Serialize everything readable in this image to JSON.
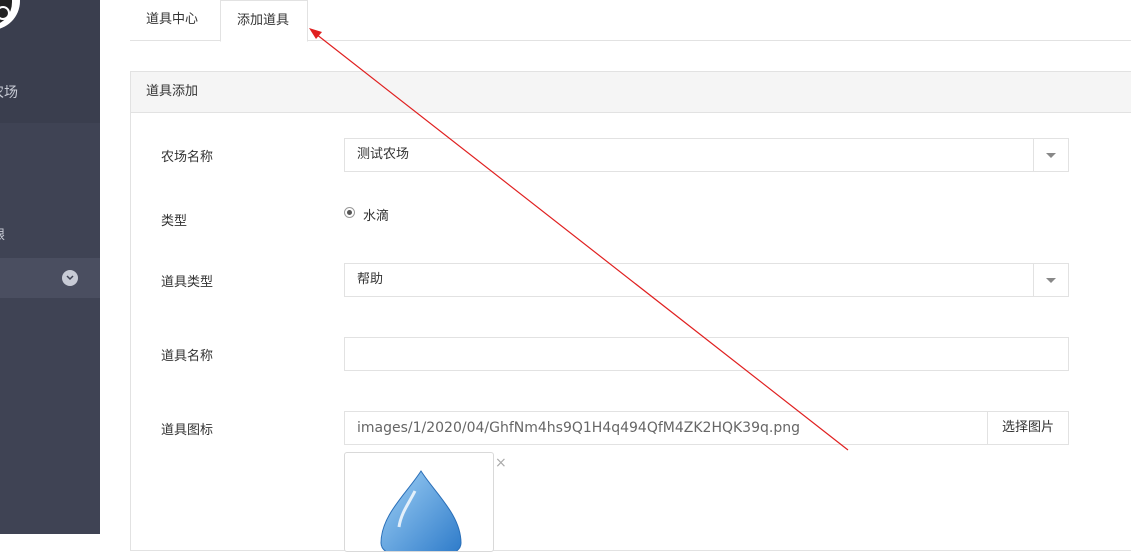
{
  "sidebar": {
    "brand_label": "农场",
    "menu_item_label": "限"
  },
  "tabs": [
    {
      "label": "道具中心"
    },
    {
      "label": "添加道具"
    }
  ],
  "panel": {
    "title": "道具添加"
  },
  "form": {
    "farm_name": {
      "label": "农场名称",
      "value": "测试农场"
    },
    "type": {
      "label": "类型",
      "option": "水滴"
    },
    "prop_type": {
      "label": "道具类型",
      "value": "帮助"
    },
    "prop_name": {
      "label": "道具名称",
      "value": ""
    },
    "prop_icon": {
      "label": "道具图标",
      "value": "images/1/2020/04/GhfNm4hs9Q1H4q494QfM4ZK2HQK39q.png",
      "button": "选择图片",
      "remove": "×"
    }
  },
  "colors": {
    "sidebar_bg": "#3f4354",
    "annotation_arrow": "#e02020",
    "droplet": "#3a8fd8"
  }
}
